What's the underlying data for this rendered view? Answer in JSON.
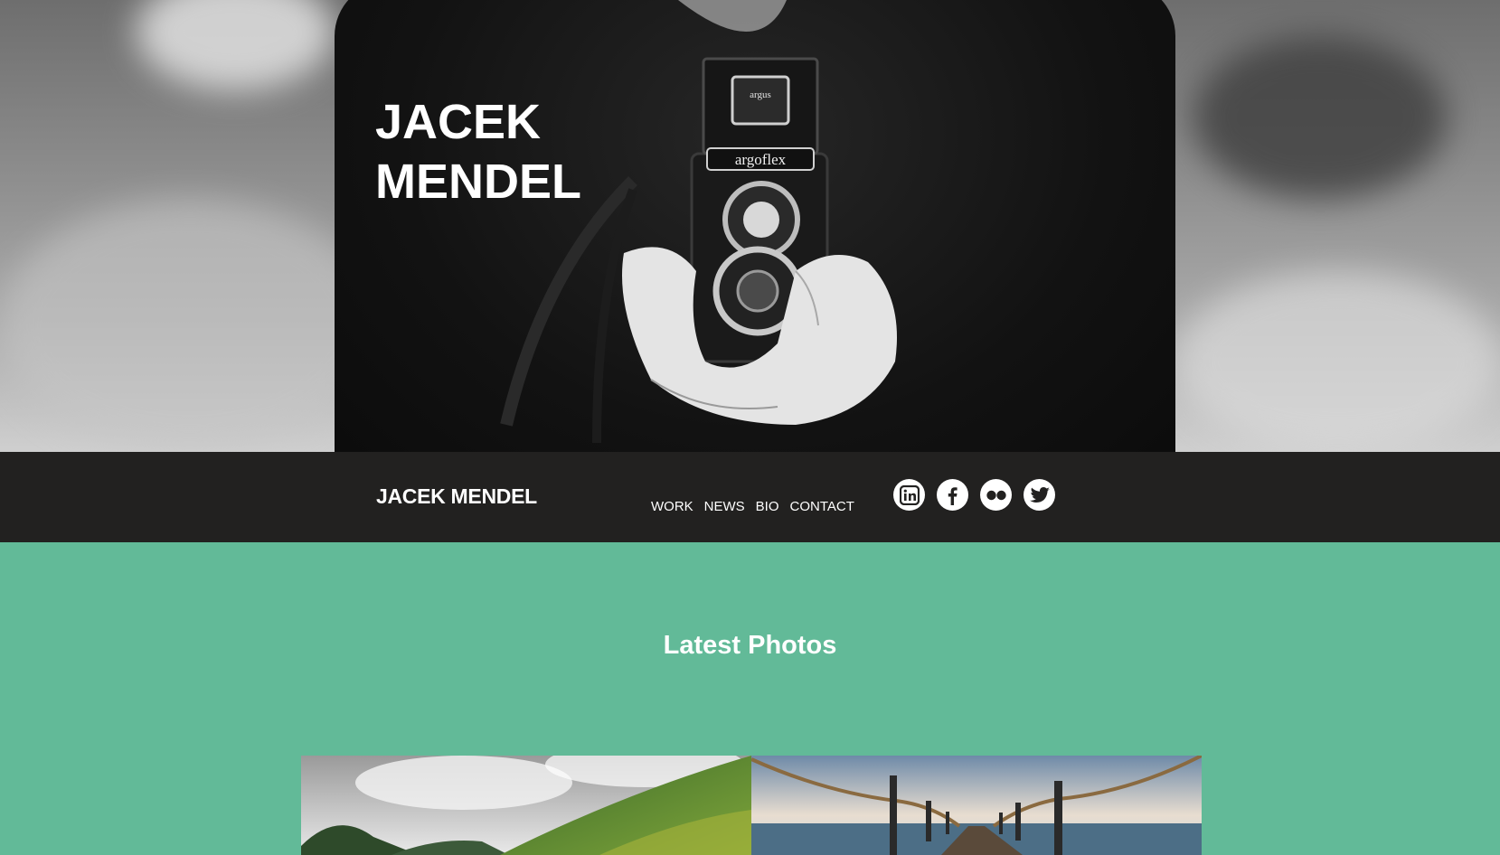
{
  "hero": {
    "name_line1": "JACEK",
    "name_line2": "MENDEL",
    "camera_label": "argoflex",
    "camera_badge": "argus"
  },
  "navbar": {
    "brand": "JACEK MENDEL",
    "menu": [
      {
        "label": "WORK"
      },
      {
        "label": "NEWS"
      },
      {
        "label": "BIO"
      },
      {
        "label": "CONTACT"
      }
    ],
    "social": [
      {
        "icon": "linkedin-icon"
      },
      {
        "icon": "facebook-icon"
      },
      {
        "icon": "flickr-icon"
      },
      {
        "icon": "twitter-icon"
      }
    ]
  },
  "latest": {
    "title": "Latest Photos"
  },
  "colors": {
    "navbar_bg": "#222120",
    "accent_green": "#62ba98",
    "text": "#ffffff"
  }
}
